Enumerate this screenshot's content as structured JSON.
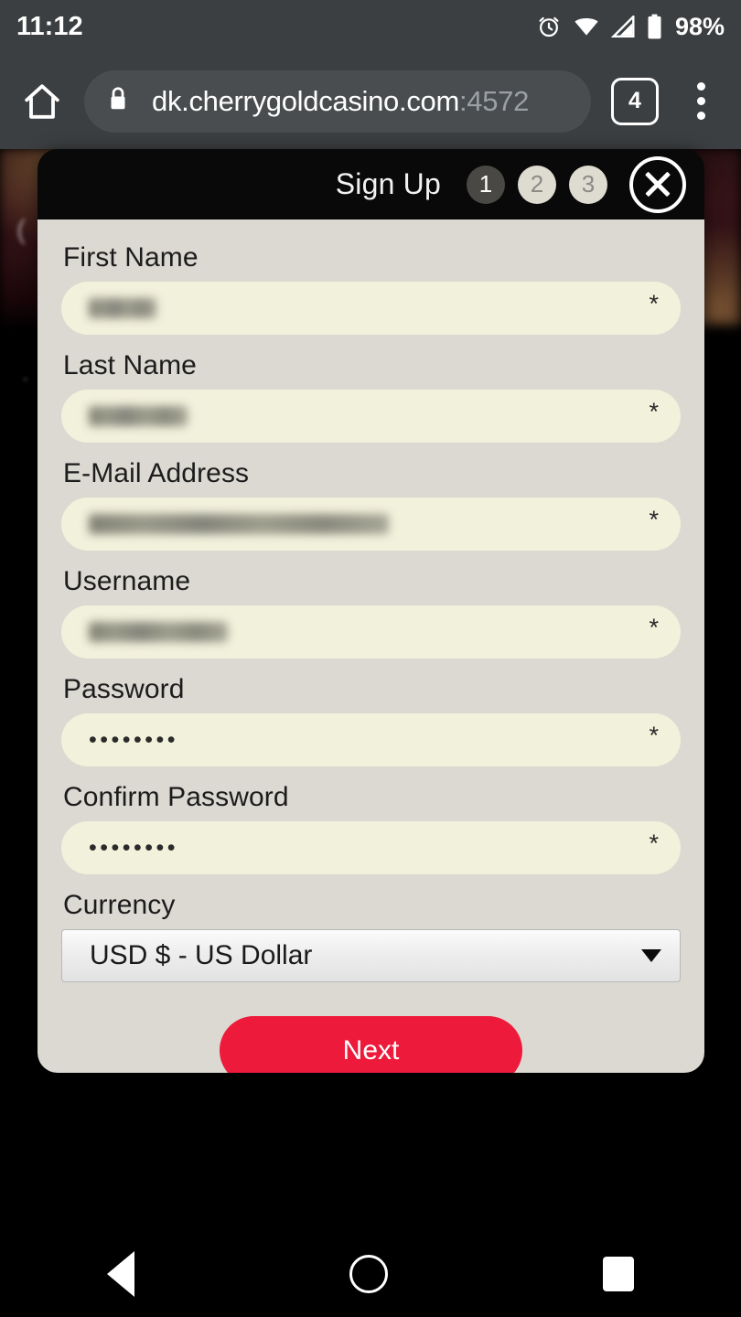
{
  "status_bar": {
    "time": "11:12",
    "battery_percent": "98%",
    "icons": [
      "alarm-icon",
      "wifi-icon",
      "cellular-signal-icon",
      "battery-icon"
    ]
  },
  "browser": {
    "home_icon": "home-icon",
    "lock_icon": "lock-icon",
    "url_host": "dk.cherrygoldcasino.com",
    "url_port": ":4572",
    "tab_count": "4",
    "menu_icon": "kebab-menu-icon"
  },
  "modal": {
    "title": "Sign Up",
    "steps": [
      {
        "label": "1",
        "active": true
      },
      {
        "label": "2",
        "active": false
      },
      {
        "label": "3",
        "active": false
      }
    ],
    "close_icon": "close-icon",
    "required_marker": "*",
    "fields": [
      {
        "label": "First Name",
        "value": "",
        "redacted": true,
        "type": "text"
      },
      {
        "label": "Last Name",
        "value": "",
        "redacted": true,
        "type": "text"
      },
      {
        "label": "E-Mail Address",
        "value": "",
        "redacted": true,
        "type": "email"
      },
      {
        "label": "Username",
        "value": "",
        "redacted": true,
        "type": "text"
      },
      {
        "label": "Password",
        "value": "••••••••",
        "redacted": false,
        "type": "password"
      },
      {
        "label": "Confirm Password",
        "value": "••••••••",
        "redacted": false,
        "type": "password"
      }
    ],
    "currency": {
      "label": "Currency",
      "selected": "USD $ - US Dollar",
      "dropdown_icon": "chevron-down-icon"
    },
    "next_label": "Next"
  },
  "nav_bar": {
    "back_icon": "back-triangle-icon",
    "home_icon": "home-circle-icon",
    "recents_icon": "recents-square-icon"
  },
  "colors": {
    "accent_red": "#ed1a3b",
    "panel_bg": "#dbd9d2",
    "input_bg": "#f2f1dc",
    "header_bg": "#090909",
    "chrome_bg": "#3c3f41"
  }
}
